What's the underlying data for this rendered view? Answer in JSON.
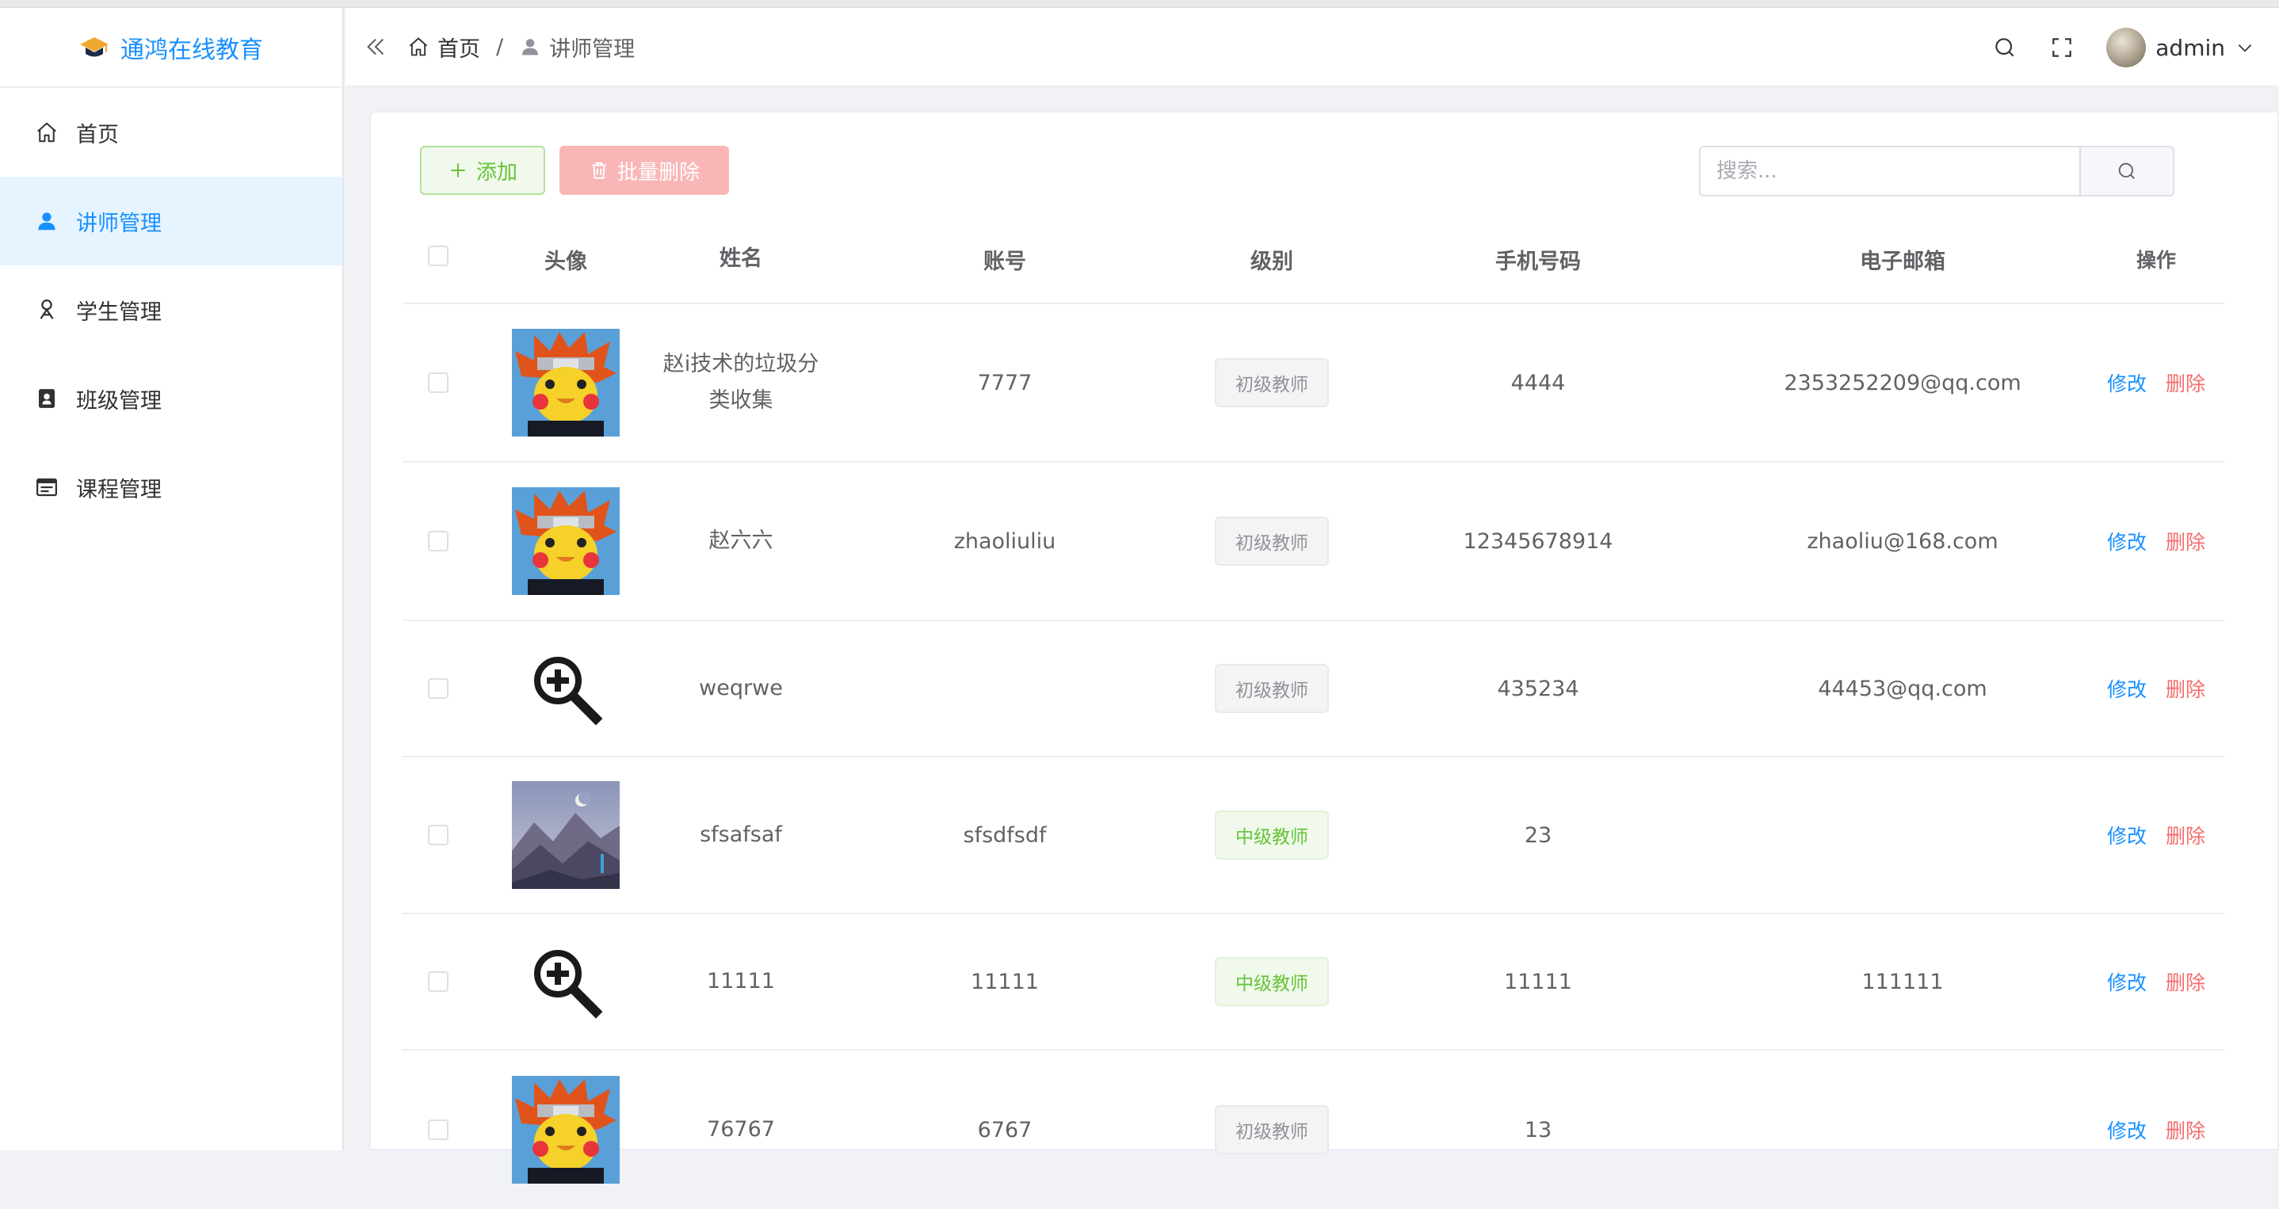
{
  "app": {
    "title": "通鸿在线教育"
  },
  "sidebar": {
    "items": [
      {
        "label": "首页",
        "icon": "home-icon"
      },
      {
        "label": "讲师管理",
        "icon": "user-icon",
        "active": true
      },
      {
        "label": "学生管理",
        "icon": "student-icon"
      },
      {
        "label": "班级管理",
        "icon": "class-icon"
      },
      {
        "label": "课程管理",
        "icon": "course-icon"
      }
    ]
  },
  "header": {
    "breadcrumb_home": "首页",
    "breadcrumb_sep": "/",
    "breadcrumb_current": "讲师管理",
    "user": "admin"
  },
  "toolbar": {
    "add_label": "添加",
    "batch_delete_label": "批量删除",
    "search_placeholder": "搜索..."
  },
  "table": {
    "columns": [
      "头像",
      "姓名",
      "账号",
      "级别",
      "手机号码",
      "电子邮箱",
      "操作"
    ],
    "rows": [
      {
        "avatar": "cartoon",
        "name": "赵i技术的垃圾分类收集",
        "account": "7777",
        "level": "初级教师",
        "phone": "4444",
        "email": "2353252209@qq.com",
        "edit": "修改",
        "delete": "删除"
      },
      {
        "avatar": "cartoon",
        "name": "赵六六",
        "account": "zhaoliuliu",
        "level": "初级教师",
        "phone": "12345678914",
        "email": "zhaoliu@168.com",
        "edit": "修改",
        "delete": "删除"
      },
      {
        "avatar": "zoom-in-placeholder",
        "name": "weqrwe",
        "account": "",
        "level": "初级教师",
        "phone": "435234",
        "email": "44453@qq.com",
        "edit": "修改",
        "delete": "删除"
      },
      {
        "avatar": "mountain",
        "name": "sfsafsaf",
        "account": "sfsdfsdf",
        "level": "中级教师",
        "phone": "23",
        "email": "",
        "edit": "修改",
        "delete": "删除"
      },
      {
        "avatar": "zoom-in-placeholder",
        "name": "11111",
        "account": "11111",
        "level": "中级教师",
        "phone": "11111",
        "email": "111111",
        "edit": "修改",
        "delete": "删除"
      },
      {
        "avatar": "cartoon",
        "name": "76767",
        "account": "6767",
        "level": "初级教师",
        "phone": "13",
        "email": "",
        "edit": "修改",
        "delete": "删除"
      }
    ]
  },
  "colors": {
    "accent": "#1890ff",
    "success": "#67c23a",
    "danger": "#f56c6c",
    "muted": "#909399"
  }
}
